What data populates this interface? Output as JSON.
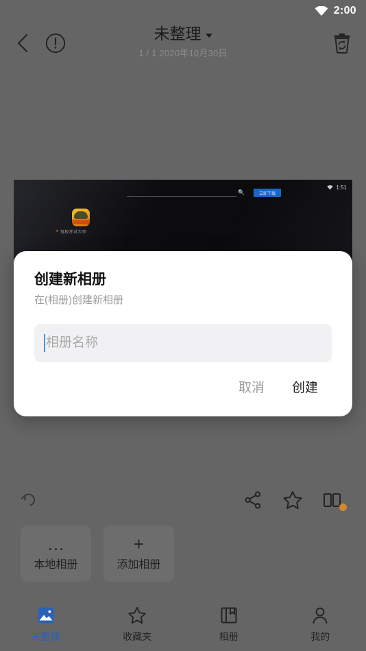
{
  "statusbar": {
    "time": "2:00",
    "wifi_icon": "wifi-icon"
  },
  "appbar": {
    "back_icon": "chevron-left-icon",
    "info_icon": "exclamation-circle-icon",
    "trash_icon": "recycle-bin-icon",
    "title": "未整理",
    "dropdown_icon": "caret-down-icon",
    "subtitle": "1 / 1  2020年10月30日"
  },
  "photo": {
    "status_time": "1:51",
    "wifi_icon": "wifi-icon",
    "search_icon": "search-icon",
    "action_button_label": "立即下载",
    "app_label": "驾校考试大师",
    "background_color": "#0b0b0d"
  },
  "dialog": {
    "title": "创建新相册",
    "subtitle": "在(相册)创建新相册",
    "input_value": "",
    "input_placeholder": "相册名称",
    "cancel_label": "取消",
    "create_label": "创建",
    "caret_color": "#4a90d9"
  },
  "toolbar": {
    "undo_icon": "undo-arrow-icon",
    "share_icon": "share-icon",
    "favorite_icon": "star-outline-icon",
    "compare_icon": "compare-split-icon",
    "badge_color": "#d98a2b"
  },
  "chips": [
    {
      "glyph": "…",
      "icon": "ellipsis-icon",
      "label": "本地相册"
    },
    {
      "glyph": "+",
      "icon": "plus-icon",
      "label": "添加相册"
    }
  ],
  "bottomnav": {
    "active_color": "#2a62b6",
    "items": [
      {
        "icon": "photo-filled-icon",
        "label": "未整理",
        "active": true
      },
      {
        "icon": "star-outline-icon",
        "label": "收藏夹",
        "active": false
      },
      {
        "icon": "album-book-icon",
        "label": "相册",
        "active": false
      },
      {
        "icon": "person-icon",
        "label": "我的",
        "active": false
      }
    ]
  }
}
